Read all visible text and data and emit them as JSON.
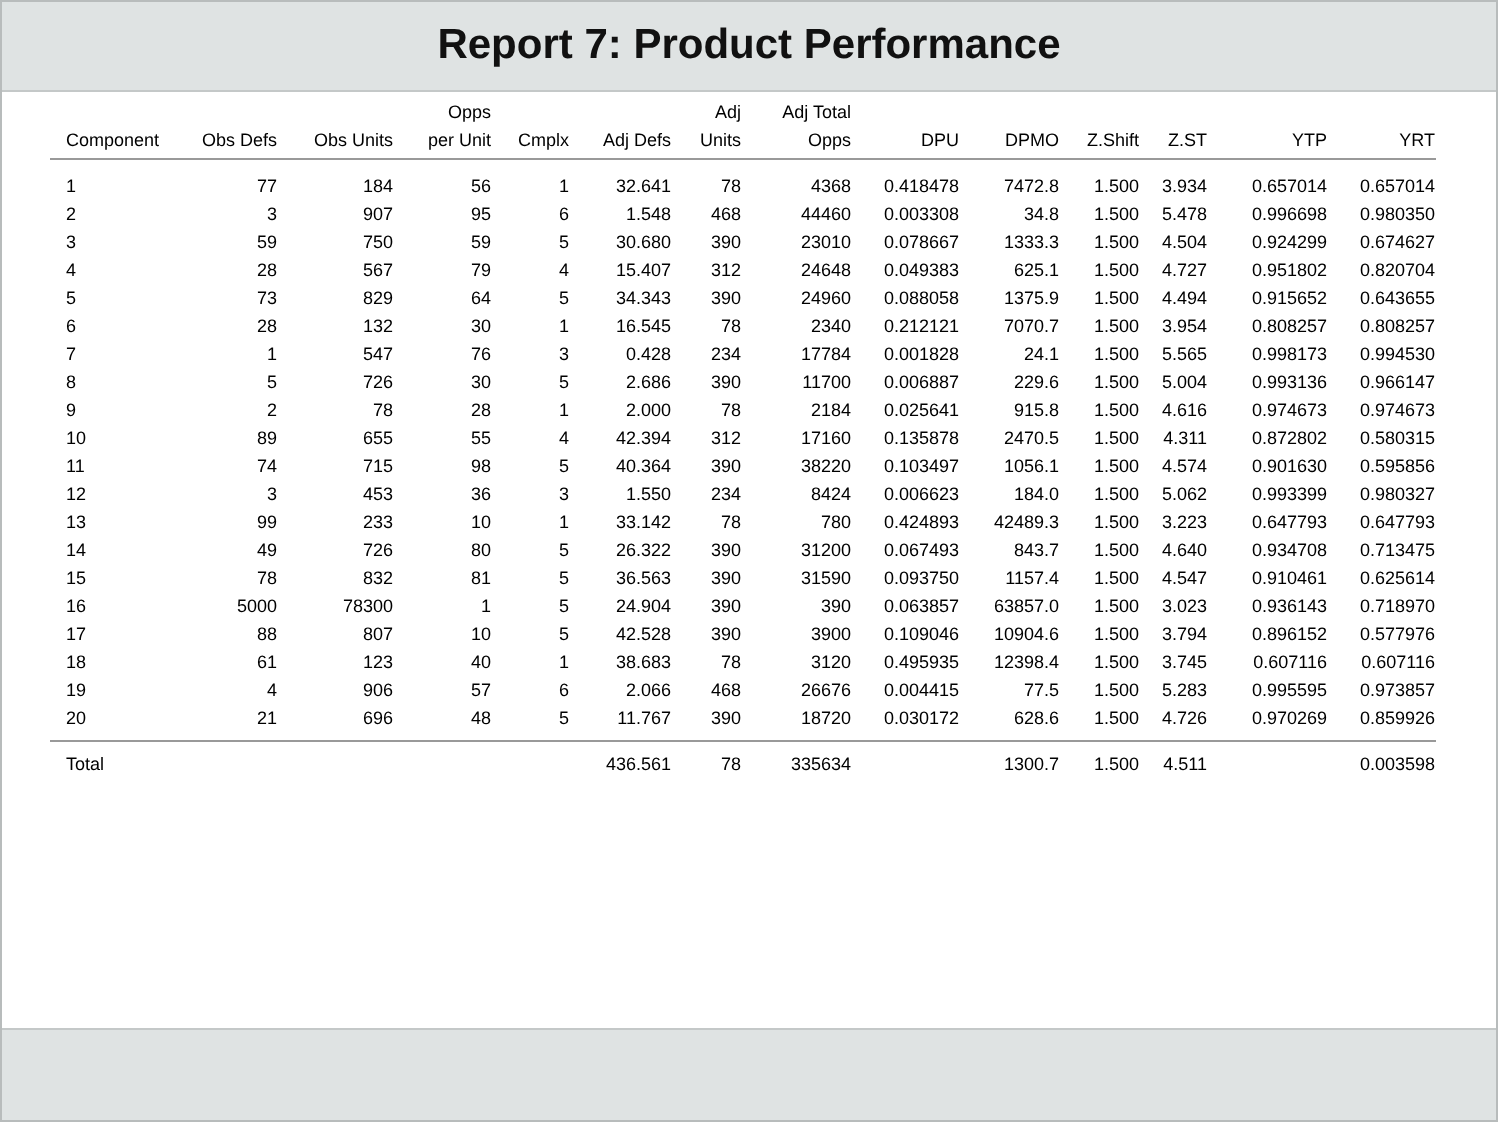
{
  "title": "Report 7: Product Performance",
  "table": {
    "columns": [
      {
        "lines": [
          "Component"
        ]
      },
      {
        "lines": [
          "Obs Defs"
        ]
      },
      {
        "lines": [
          "Obs Units"
        ]
      },
      {
        "lines": [
          "Opps",
          "per Unit"
        ]
      },
      {
        "lines": [
          "Cmplx"
        ]
      },
      {
        "lines": [
          "Adj Defs"
        ]
      },
      {
        "lines": [
          "Adj",
          "Units"
        ]
      },
      {
        "lines": [
          "Adj Total",
          "Opps"
        ]
      },
      {
        "lines": [
          "DPU"
        ]
      },
      {
        "lines": [
          "DPMO"
        ]
      },
      {
        "lines": [
          "Z.Shift"
        ]
      },
      {
        "lines": [
          "Z.ST"
        ]
      },
      {
        "lines": [
          "YTP"
        ]
      },
      {
        "lines": [
          "YRT"
        ]
      }
    ],
    "rows": [
      [
        "1",
        "77",
        "184",
        "56",
        "1",
        "32.641",
        "78",
        "4368",
        "0.418478",
        "7472.8",
        "1.500",
        "3.934",
        "0.657014",
        "0.657014"
      ],
      [
        "2",
        "3",
        "907",
        "95",
        "6",
        "1.548",
        "468",
        "44460",
        "0.003308",
        "34.8",
        "1.500",
        "5.478",
        "0.996698",
        "0.980350"
      ],
      [
        "3",
        "59",
        "750",
        "59",
        "5",
        "30.680",
        "390",
        "23010",
        "0.078667",
        "1333.3",
        "1.500",
        "4.504",
        "0.924299",
        "0.674627"
      ],
      [
        "4",
        "28",
        "567",
        "79",
        "4",
        "15.407",
        "312",
        "24648",
        "0.049383",
        "625.1",
        "1.500",
        "4.727",
        "0.951802",
        "0.820704"
      ],
      [
        "5",
        "73",
        "829",
        "64",
        "5",
        "34.343",
        "390",
        "24960",
        "0.088058",
        "1375.9",
        "1.500",
        "4.494",
        "0.915652",
        "0.643655"
      ],
      [
        "6",
        "28",
        "132",
        "30",
        "1",
        "16.545",
        "78",
        "2340",
        "0.212121",
        "7070.7",
        "1.500",
        "3.954",
        "0.808257",
        "0.808257"
      ],
      [
        "7",
        "1",
        "547",
        "76",
        "3",
        "0.428",
        "234",
        "17784",
        "0.001828",
        "24.1",
        "1.500",
        "5.565",
        "0.998173",
        "0.994530"
      ],
      [
        "8",
        "5",
        "726",
        "30",
        "5",
        "2.686",
        "390",
        "11700",
        "0.006887",
        "229.6",
        "1.500",
        "5.004",
        "0.993136",
        "0.966147"
      ],
      [
        "9",
        "2",
        "78",
        "28",
        "1",
        "2.000",
        "78",
        "2184",
        "0.025641",
        "915.8",
        "1.500",
        "4.616",
        "0.974673",
        "0.974673"
      ],
      [
        "10",
        "89",
        "655",
        "55",
        "4",
        "42.394",
        "312",
        "17160",
        "0.135878",
        "2470.5",
        "1.500",
        "4.311",
        "0.872802",
        "0.580315"
      ],
      [
        "11",
        "74",
        "715",
        "98",
        "5",
        "40.364",
        "390",
        "38220",
        "0.103497",
        "1056.1",
        "1.500",
        "4.574",
        "0.901630",
        "0.595856"
      ],
      [
        "12",
        "3",
        "453",
        "36",
        "3",
        "1.550",
        "234",
        "8424",
        "0.006623",
        "184.0",
        "1.500",
        "5.062",
        "0.993399",
        "0.980327"
      ],
      [
        "13",
        "99",
        "233",
        "10",
        "1",
        "33.142",
        "78",
        "780",
        "0.424893",
        "42489.3",
        "1.500",
        "3.223",
        "0.647793",
        "0.647793"
      ],
      [
        "14",
        "49",
        "726",
        "80",
        "5",
        "26.322",
        "390",
        "31200",
        "0.067493",
        "843.7",
        "1.500",
        "4.640",
        "0.934708",
        "0.713475"
      ],
      [
        "15",
        "78",
        "832",
        "81",
        "5",
        "36.563",
        "390",
        "31590",
        "0.093750",
        "1157.4",
        "1.500",
        "4.547",
        "0.910461",
        "0.625614"
      ],
      [
        "16",
        "5000",
        "78300",
        "1",
        "5",
        "24.904",
        "390",
        "390",
        "0.063857",
        "63857.0",
        "1.500",
        "3.023",
        "0.936143",
        "0.718970"
      ],
      [
        "17",
        "88",
        "807",
        "10",
        "5",
        "42.528",
        "390",
        "3900",
        "0.109046",
        "10904.6",
        "1.500",
        "3.794",
        "0.896152",
        "0.577976"
      ],
      [
        "18",
        "61",
        "123",
        "40",
        "1",
        "38.683",
        "78",
        "3120",
        "0.495935",
        "12398.4",
        "1.500",
        "3.745",
        "0.607116",
        "0.607116"
      ],
      [
        "19",
        "4",
        "906",
        "57",
        "6",
        "2.066",
        "468",
        "26676",
        "0.004415",
        "77.5",
        "1.500",
        "5.283",
        "0.995595",
        "0.973857"
      ],
      [
        "20",
        "21",
        "696",
        "48",
        "5",
        "11.767",
        "390",
        "18720",
        "0.030172",
        "628.6",
        "1.500",
        "4.726",
        "0.970269",
        "0.859926"
      ]
    ],
    "total": {
      "label": "Total",
      "adj_defs": "436.561",
      "adj_units": "78",
      "adj_total_opps": "335634",
      "dpmo": "1300.7",
      "z_shift": "1.500",
      "z_st": "4.511",
      "yrt": "0.003598"
    }
  }
}
